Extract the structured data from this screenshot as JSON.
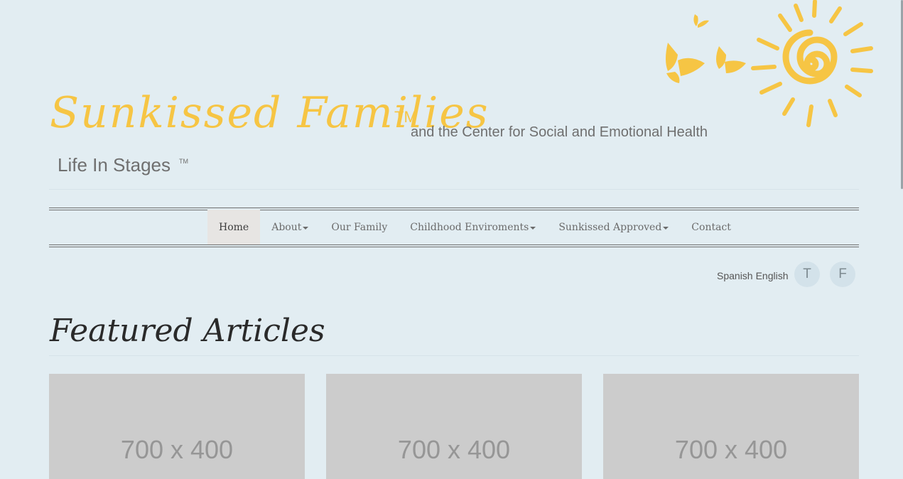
{
  "header": {
    "brand": "Sunkissed Families",
    "brand_tm": "TM",
    "tagline": "and the Center for Social and Emotional Health",
    "subtitle": "Life In Stages",
    "subtitle_tm": "TM"
  },
  "nav": {
    "items": [
      {
        "label": "Home",
        "active": true,
        "dropdown": false
      },
      {
        "label": "About",
        "active": false,
        "dropdown": true
      },
      {
        "label": "Our Family",
        "active": false,
        "dropdown": false
      },
      {
        "label": "Childhood Enviroments",
        "active": false,
        "dropdown": true
      },
      {
        "label": "Sunkissed Approved",
        "active": false,
        "dropdown": true
      },
      {
        "label": "Contact",
        "active": false,
        "dropdown": false
      }
    ]
  },
  "language": {
    "spanish": "Spanish",
    "english": "English"
  },
  "social": {
    "twitter": "T",
    "facebook": "F"
  },
  "featured": {
    "heading": "Featured Articles",
    "cards": [
      {
        "placeholder": "700 x 400"
      },
      {
        "placeholder": "700 x 400"
      },
      {
        "placeholder": "700 x 400"
      }
    ]
  },
  "colors": {
    "background": "#e2edf2",
    "brand_yellow": "#f6c544",
    "text_gray": "#6f6f6f",
    "placeholder_gray": "#cccccc"
  },
  "icons": {
    "sun": "sun-icon",
    "butterflies": "butterfly-icon"
  }
}
